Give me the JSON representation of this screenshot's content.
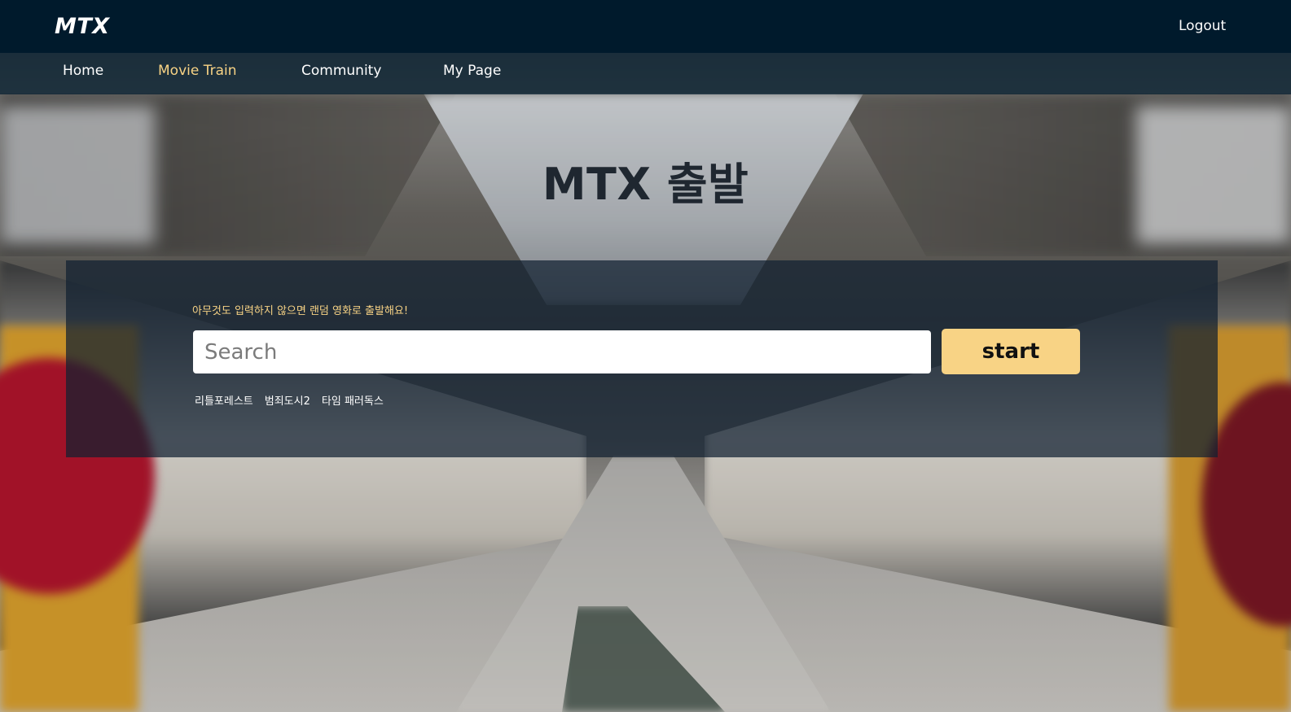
{
  "header": {
    "logo": "MTX",
    "logout_label": "Logout"
  },
  "nav": {
    "items": [
      {
        "label": "Home"
      },
      {
        "label": "Movie Train",
        "active": true
      },
      {
        "label": "Community"
      },
      {
        "label": "My Page"
      }
    ]
  },
  "hero": {
    "title": "MTX 출발"
  },
  "search": {
    "hint": "아무것도 입력하지 않으면 랜덤 영화로 출발해요!",
    "placeholder": "Search",
    "value": "",
    "start_label": "start",
    "suggestions": [
      "리틀포레스트",
      "범죄도시2",
      "타임 패러독스"
    ]
  },
  "colors": {
    "header_bg": "#001a2c",
    "accent": "#f8d385"
  },
  "icons": {
    "background": "train-station-background-image"
  }
}
